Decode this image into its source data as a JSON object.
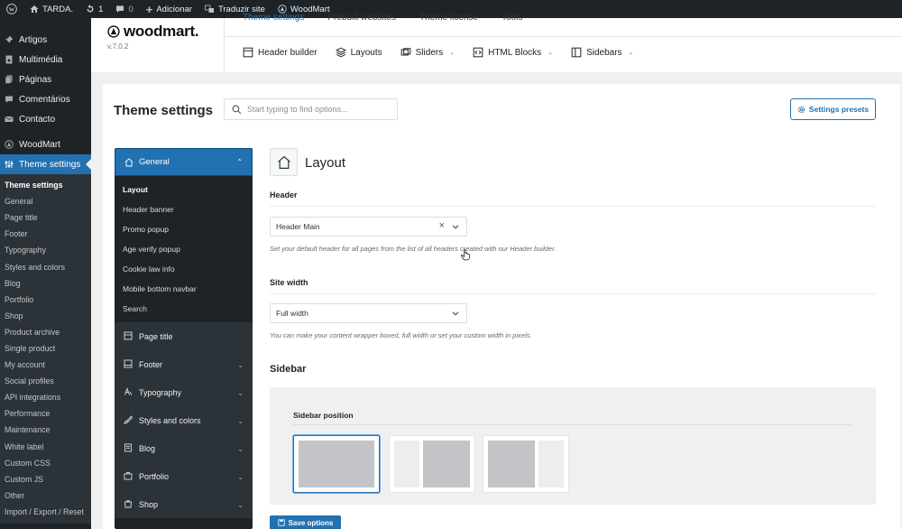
{
  "adminbar": {
    "site_name": "TARDA.",
    "updates_count": "1",
    "comments_count": "0",
    "add_new": "Adicionar",
    "translate": "Traduzir site",
    "woodmart": "WoodMart"
  },
  "adminmenu": {
    "items": [
      "Artigos",
      "Multimédia",
      "Páginas",
      "Comentários",
      "Contacto"
    ],
    "woodmart": "WoodMart",
    "theme_settings": "Theme settings",
    "submenu": [
      "Theme settings",
      "General",
      "Page title",
      "Footer",
      "Typography",
      "Styles and colors",
      "Blog",
      "Portfolio",
      "Shop",
      "Product archive",
      "Single product",
      "My account",
      "Social profiles",
      "API integrations",
      "Performance",
      "Maintenance",
      "White label",
      "Custom CSS",
      "Custom JS",
      "Other",
      "Import / Export / Reset"
    ]
  },
  "wm_header": {
    "logo": "woodmart.",
    "version": "v.7.0.2",
    "top_tabs": [
      "Theme settings",
      "Prebuilt websites",
      "Theme license",
      "Tools"
    ],
    "nav": [
      "Header builder",
      "Layouts",
      "Sliders",
      "HTML Blocks",
      "Sidebars"
    ]
  },
  "panel": {
    "title": "Theme settings",
    "search_placeholder": "Start typing to find options...",
    "presets_button": "Settings presets"
  },
  "settings_nav": {
    "active_section": "General",
    "sub_items": [
      "Layout",
      "Header banner",
      "Promo popup",
      "Age verify popup",
      "Cookie law info",
      "Mobile bottom navbar",
      "Search"
    ],
    "sections": [
      "Page title",
      "Footer",
      "Typography",
      "Styles and colors",
      "Blog",
      "Portfolio",
      "Shop"
    ]
  },
  "content": {
    "title": "Layout",
    "header_label": "Header",
    "header_value": "Header Main",
    "header_help": "Set your default header for all pages from the list of all headers created with our Header builder.",
    "site_width_label": "Site width",
    "site_width_value": "Full width",
    "site_width_help": "You can make your content wrapper boxed, full width or set your custom width in pixels.",
    "sidebar_title": "Sidebar",
    "sidebar_position_label": "Sidebar position",
    "sidebar_position_options": [
      "Without",
      "Left",
      "Right"
    ],
    "sidebar_position_selected": "Without",
    "save_button": "Save options"
  }
}
